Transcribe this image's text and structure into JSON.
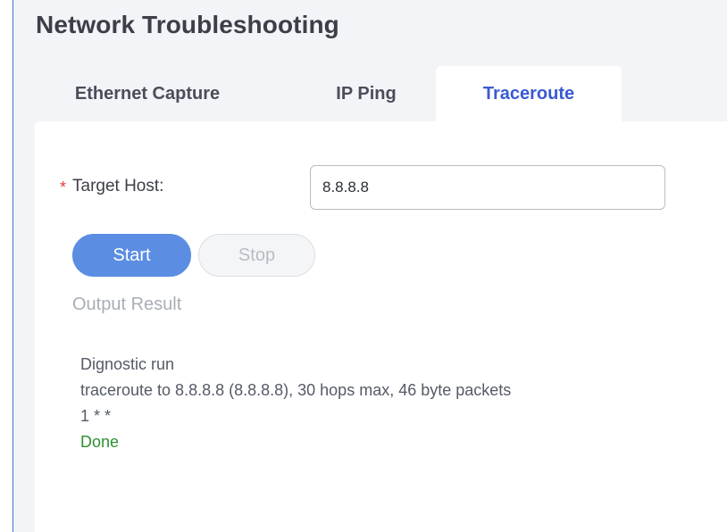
{
  "page": {
    "title": "Network Troubleshooting"
  },
  "tabs": [
    {
      "label": "Ethernet Capture",
      "active": false
    },
    {
      "label": "IP Ping",
      "active": false
    },
    {
      "label": "Traceroute",
      "active": true
    }
  ],
  "form": {
    "required_marker": "*",
    "target_host_label": "Target Host:",
    "target_host_value": "8.8.8.8"
  },
  "buttons": {
    "start_label": "Start",
    "stop_label": "Stop"
  },
  "output": {
    "title": "Output Result",
    "lines": [
      "Dignostic run",
      "traceroute to 8.8.8.8 (8.8.8.8), 30 hops max, 46 byte packets",
      "1 * *",
      "Done"
    ]
  },
  "colors": {
    "accent": "#3a5ad1",
    "start_button": "#5b8de3",
    "required": "#e03c3c",
    "done": "#2f8f2f"
  }
}
